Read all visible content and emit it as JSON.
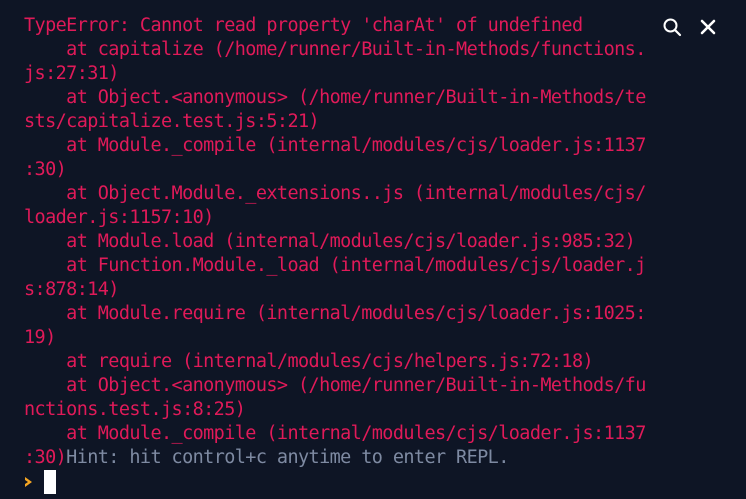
{
  "console": {
    "lines": [
      "TypeError: Cannot read property 'charAt' of undefined",
      "    at capitalize (/home/runner/Built-in-Methods/functions.",
      "js:27:31)",
      "    at Object.<anonymous> (/home/runner/Built-in-Methods/te",
      "sts/capitalize.test.js:5:21)",
      "    at Module._compile (internal/modules/cjs/loader.js:1137",
      ":30)",
      "    at Object.Module._extensions..js (internal/modules/cjs/",
      "loader.js:1157:10)",
      "    at Module.load (internal/modules/cjs/loader.js:985:32)",
      "    at Function.Module._load (internal/modules/cjs/loader.j",
      "s:878:14)",
      "    at Module.require (internal/modules/cjs/loader.js:1025:",
      "19)",
      "    at require (internal/modules/cjs/helpers.js:72:18)",
      "    at Object.<anonymous> (/home/runner/Built-in-Methods/fu",
      "nctions.test.js:8:25)",
      "    at Module._compile (internal/modules/cjs/loader.js:1137"
    ],
    "last_line_error": ":30)",
    "hint": "Hint: hit control+c anytime to enter REPL."
  },
  "toolbar": {
    "search_icon": "search-icon",
    "close_icon": "close-icon"
  },
  "prompt": {
    "icon": "prompt-chevron-icon"
  },
  "colors": {
    "background": "#0e1525",
    "error_text": "#e01a59",
    "hint_text": "#7e8aa2",
    "prompt_accent": "#f5a623",
    "cursor": "#ffffff",
    "icon": "#ffffff"
  }
}
